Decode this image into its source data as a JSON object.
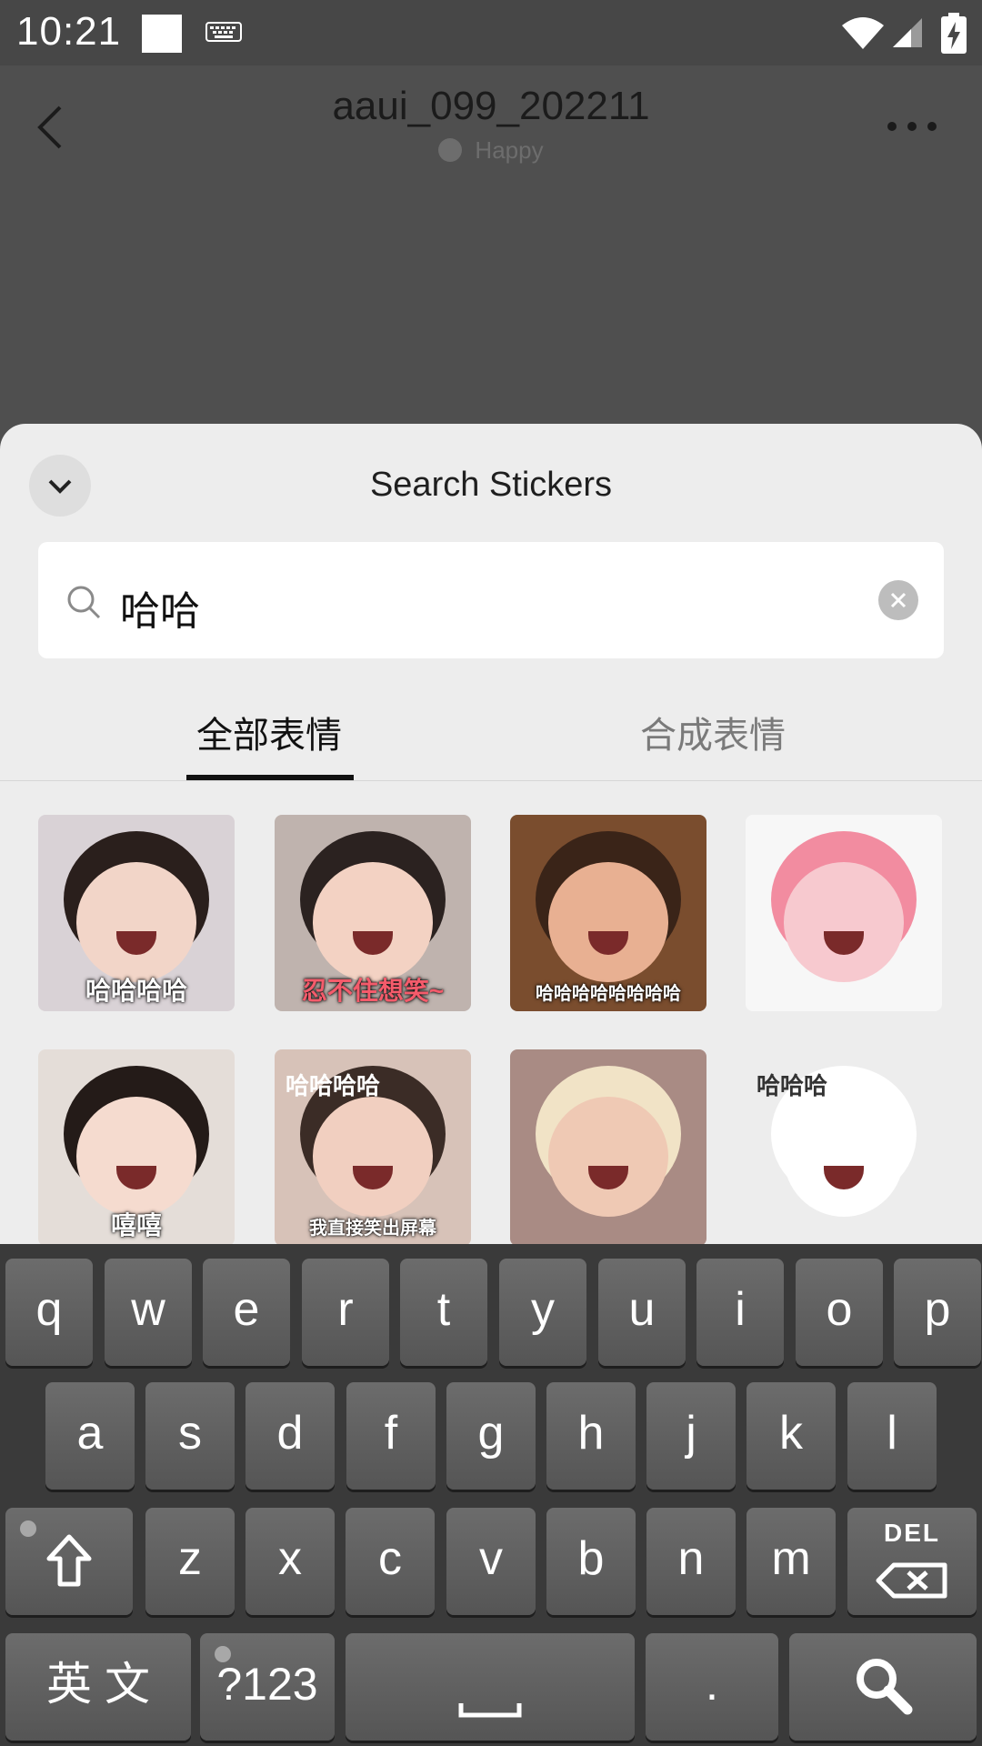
{
  "status_bar": {
    "time": "10:21",
    "icons": [
      "notification-square-icon",
      "keyboard-icon",
      "wifi-icon",
      "signal-icon",
      "battery-charging-icon"
    ]
  },
  "chat": {
    "title": "aaui_099_202211",
    "status": "Happy",
    "icons": [
      "back-arrow-icon",
      "smile-icon",
      "more-icon"
    ]
  },
  "sticker_search": {
    "title": "Search Stickers",
    "query": "哈哈",
    "tabs": [
      {
        "label": "全部表情",
        "active": true
      },
      {
        "label": "合成表情",
        "active": false
      }
    ],
    "stickers": [
      {
        "caption": "哈哈哈哈",
        "bg": "#d9d2d6",
        "skin": "#f2d5c8",
        "hair": "#2a1f1c",
        "cap_color": "#ffffff"
      },
      {
        "caption": "忍不住想笑~",
        "bg": "#bfb3ae",
        "skin": "#f3d2c3",
        "hair": "#2b2220",
        "cap_color": "#f45b6b"
      },
      {
        "caption": "哈哈哈哈哈哈哈哈",
        "bg": "#7a4d2e",
        "skin": "#e8b092",
        "hair": "#3a2418",
        "cap_color": "#ffffff"
      },
      {
        "caption": "",
        "bg": "#f7f7f7",
        "skin": "#f7c9cf",
        "hair": "#f28ca0",
        "cap_color": "#ffffff"
      },
      {
        "caption": "嘻嘻",
        "bg": "#e4ddd8",
        "skin": "#f5dbcf",
        "hair": "#241b18",
        "cap_color": "#ffffff"
      },
      {
        "caption": "我直接笑出屏幕",
        "bg": "#d7c2b8",
        "skin": "#f1cfc0",
        "hair": "#3b2c26",
        "cap_color": "#ffffff",
        "side_text": "哈哈哈哈"
      },
      {
        "caption": "",
        "bg": "#a98b84",
        "skin": "#efc9b4",
        "hair": "#f1e3c6",
        "cap_color": "#ffffff"
      },
      {
        "caption": "",
        "bg": "#ededed",
        "skin": "#ffffff",
        "hair": "#ffffff",
        "cap_color": "#333333",
        "side_text": "哈哈哈"
      }
    ]
  },
  "keyboard": {
    "row1": [
      "q",
      "w",
      "e",
      "r",
      "t",
      "y",
      "u",
      "i",
      "o",
      "p"
    ],
    "row2": [
      "a",
      "s",
      "d",
      "f",
      "g",
      "h",
      "j",
      "k",
      "l"
    ],
    "row3": [
      "z",
      "x",
      "c",
      "v",
      "b",
      "n",
      "m"
    ],
    "del_label": "DEL",
    "lang_label": "英 文",
    "symbols_label": "?123",
    "period_label": ".",
    "icons": [
      "shift-icon",
      "delete-icon",
      "space-icon",
      "search-icon"
    ]
  },
  "colors": {
    "overlay": "#4f4f4f",
    "sheet_bg": "#ededed",
    "keyboard_bg": "#3a3a3a",
    "key_face": "#616161"
  }
}
